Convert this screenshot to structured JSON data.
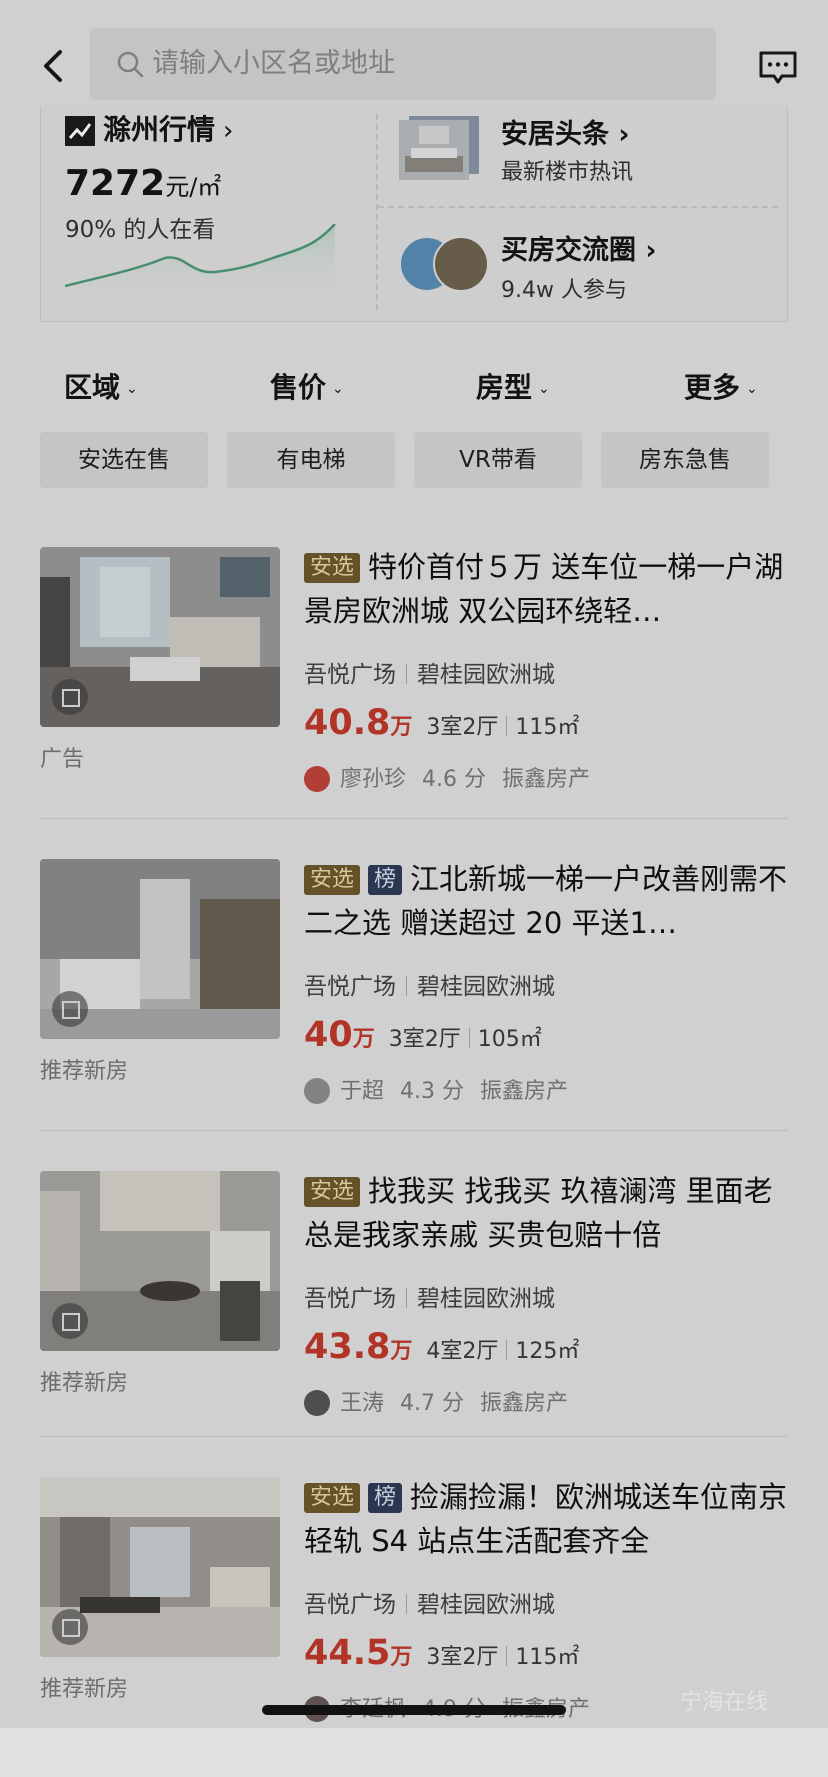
{
  "search": {
    "placeholder": "请输入小区名或地址"
  },
  "market": {
    "title": "滁州行情",
    "price": "7272",
    "unit": "元/㎡",
    "watching": "90% 的人在看"
  },
  "news": {
    "title": "安居头条",
    "subtitle": "最新楼市热讯"
  },
  "circle": {
    "title": "买房交流圈",
    "subtitle": "9.4w 人参与"
  },
  "filters": [
    "区域",
    "售价",
    "房型",
    "更多"
  ],
  "chips": [
    "安选在售",
    "有电梯",
    "VR带看",
    "房东急售"
  ],
  "listings": [
    {
      "tags": [
        "安选"
      ],
      "title": "特价首付５万 送车位一梯一户湖景房欧洲城 双公园环绕轻…",
      "area": "吾悦广场",
      "community": "碧桂园欧洲城",
      "price": "40.8",
      "price_unit": "万",
      "layout": "3室2厅",
      "size": "115㎡",
      "agent": "廖孙珍",
      "score": "4.6 分",
      "agency": "振鑫房产",
      "note": "广告"
    },
    {
      "tags": [
        "安选",
        "榜"
      ],
      "title": "江北新城一梯一户改善刚需不二之选 赠送超过 20 平送1…",
      "area": "吾悦广场",
      "community": "碧桂园欧洲城",
      "price": "40",
      "price_unit": "万",
      "layout": "3室2厅",
      "size": "105㎡",
      "agent": "于超",
      "score": "4.3 分",
      "agency": "振鑫房产",
      "note": "推荐新房"
    },
    {
      "tags": [
        "安选"
      ],
      "title": "找我买 找我买 玖禧澜湾 里面老总是我家亲戚 买贵包赔十倍",
      "area": "吾悦广场",
      "community": "碧桂园欧洲城",
      "price": "43.8",
      "price_unit": "万",
      "layout": "4室2厅",
      "size": "125㎡",
      "agent": "王涛",
      "score": "4.7 分",
      "agency": "振鑫房产",
      "note": "推荐新房"
    },
    {
      "tags": [
        "安选",
        "榜"
      ],
      "title": "捡漏捡漏！欧洲城送车位南京轻轨 S4 站点生活配套齐全",
      "area": "吾悦广场",
      "community": "碧桂园欧洲城",
      "price": "44.5",
      "price_unit": "万",
      "layout": "3室2厅",
      "size": "115㎡",
      "agent": "李廷枫",
      "score": "4.9 分",
      "agency": "振鑫房产",
      "note": "推荐新房"
    }
  ],
  "watermark": "宁海在线",
  "colors": {
    "price": "#c1392b",
    "tag_gold": "#6f5a2c",
    "tag_navy": "#2f3c58"
  }
}
